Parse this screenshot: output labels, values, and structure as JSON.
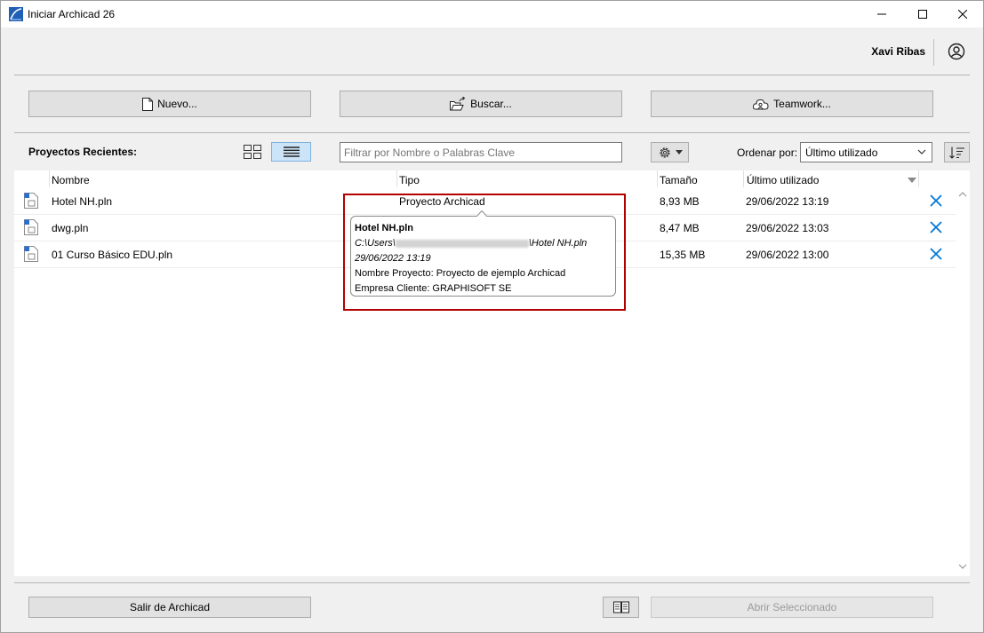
{
  "window": {
    "title": "Iniciar Archicad 26"
  },
  "user": {
    "name": "Xavi Ribas"
  },
  "actions": {
    "new_label": "Nuevo...",
    "browse_label": "Buscar...",
    "teamwork_label": "Teamwork..."
  },
  "recent": {
    "label": "Proyectos Recientes:",
    "filter_placeholder": "Filtrar por Nombre o Palabras Clave",
    "sort_label": "Ordenar por:",
    "sort_value": "Último utilizado",
    "columns": {
      "name": "Nombre",
      "type": "Tipo",
      "size": "Tamaño",
      "last_used": "Último utilizado"
    },
    "rows": [
      {
        "name": "Hotel NH.pln",
        "type": "Proyecto Archicad",
        "size": "8,93 MB",
        "last_used": "29/06/2022 13:19"
      },
      {
        "name": "dwg.pln",
        "type": "",
        "size": "8,47 MB",
        "last_used": "29/06/2022 13:03"
      },
      {
        "name": "01 Curso Básico EDU.pln",
        "type": "",
        "size": "15,35 MB",
        "last_used": "29/06/2022 13:00"
      }
    ]
  },
  "tooltip": {
    "title": "Hotel NH.pln",
    "path_prefix": "C:\\Users\\",
    "path_suffix": "\\Hotel NH.pln",
    "date": "29/06/2022 13:19",
    "project_name": "Nombre Proyecto: Proyecto de ejemplo Archicad",
    "client": "Empresa Cliente: GRAPHISOFT SE"
  },
  "footer": {
    "quit_label": "Salir de Archicad",
    "open_label": "Abrir Seleccionado"
  },
  "colors": {
    "accent": "#0078d7",
    "highlight_border": "#b00000"
  }
}
